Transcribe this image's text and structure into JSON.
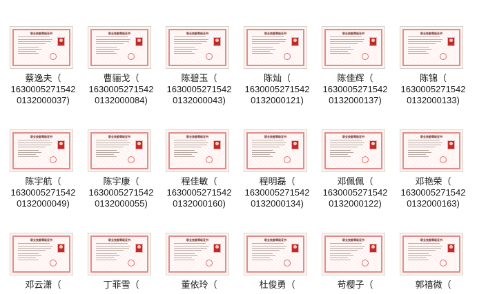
{
  "files": [
    {
      "name": "蔡逸夫（",
      "l2": "1630005271542",
      "l3": "0132000037)"
    },
    {
      "name": "曹骊戈（",
      "l2": "1630005271542",
      "l3": "0132000084)"
    },
    {
      "name": "陈碧玉（",
      "l2": "1630005271542",
      "l3": "0132000043)"
    },
    {
      "name": "陈灿（",
      "l2": "1630005271542",
      "l3": "0132000121)"
    },
    {
      "name": "陈佳辉（",
      "l2": "1630005271542",
      "l3": "0132000137)"
    },
    {
      "name": "陈锦（",
      "l2": "1630005271542",
      "l3": "0132000133)"
    },
    {
      "name": "陈宇航（",
      "l2": "1630005271542",
      "l3": "0132000049)"
    },
    {
      "name": "陈宇康（",
      "l2": "1630005271542",
      "l3": "0132000055)"
    },
    {
      "name": "程佳敏（",
      "l2": "1630005271542",
      "l3": "0132000160)"
    },
    {
      "name": "程明磊（",
      "l2": "1630005271542",
      "l3": "0132000134)"
    },
    {
      "name": "邓佩佩（",
      "l2": "1630005271542",
      "l3": "0132000122)"
    },
    {
      "name": "邓艳荣（",
      "l2": "1630005271542",
      "l3": "0132000163)"
    },
    {
      "name": "邓云潇（",
      "l2": "",
      "l3": ""
    },
    {
      "name": "丁菲雪（",
      "l2": "",
      "l3": ""
    },
    {
      "name": "董依玲（",
      "l2": "",
      "l3": ""
    },
    {
      "name": "杜俊勇（",
      "l2": "",
      "l3": ""
    },
    {
      "name": "苟樱子（",
      "l2": "",
      "l3": ""
    },
    {
      "name": "郭禧微（",
      "l2": "",
      "l3": ""
    }
  ],
  "certificate": {
    "title": "职业技能等级证书",
    "accent_color": "#e58a8a",
    "photo_color": "#c62828"
  }
}
